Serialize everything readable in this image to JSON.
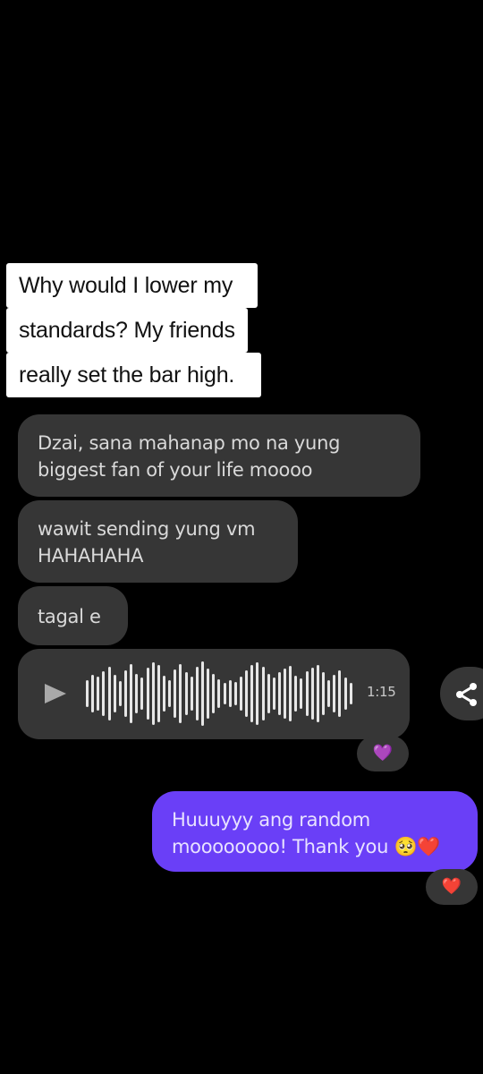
{
  "overlay_caption": {
    "lines": [
      "Why would I lower my",
      "standards? My friends",
      "really set the bar high."
    ]
  },
  "messages": {
    "incoming": [
      {
        "text": "Dzai, sana mahanap mo na yung biggest fan of your life moooo"
      },
      {
        "text": "wawit sending yung vm HAHAHAHA"
      },
      {
        "text": "tagal e"
      }
    ],
    "voice_message": {
      "duration": "1:15",
      "reaction": "💜"
    },
    "outgoing": {
      "text": "Huuuyyy ang random moooooooo! Thank you 🥺❤️",
      "reaction": "❤️"
    }
  },
  "icons": {
    "play": "play-icon",
    "share": "share-icon"
  },
  "colors": {
    "background": "#000000",
    "incoming_bubble": "#363636",
    "outgoing_bubble": "#6a3ff7",
    "caption_bg": "#ffffff"
  }
}
